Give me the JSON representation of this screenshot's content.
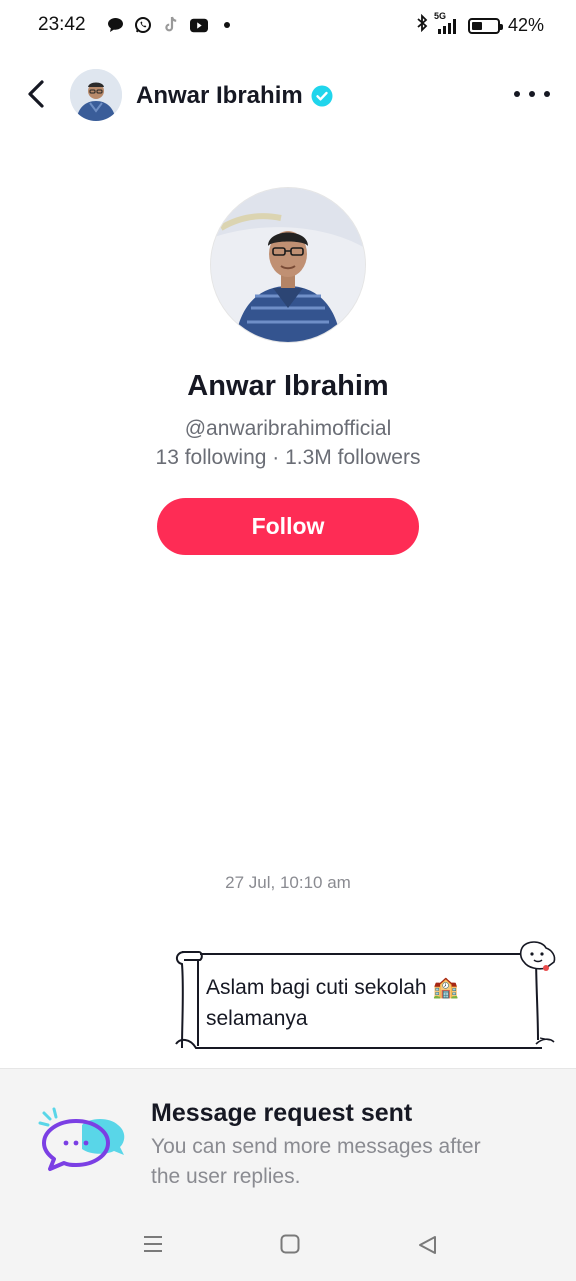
{
  "status_bar": {
    "time": "23:42",
    "battery_percent": "42%",
    "battery_level": 0.42,
    "network": "5G",
    "icons": [
      "chat-bubble-icon",
      "whatsapp-icon",
      "tiktok-icon",
      "youtube-icon",
      "dot-icon",
      "bluetooth-icon",
      "signal-icon",
      "battery-icon"
    ]
  },
  "header": {
    "name": "Anwar Ibrahim",
    "verified": true,
    "icons": [
      "back-arrow-icon",
      "verified-badge-icon",
      "more-icon"
    ]
  },
  "profile": {
    "name": "Anwar Ibrahim",
    "handle": "@anwaribrahimofficial",
    "stats": "13 following · 1.3M followers",
    "follow_label": "Follow"
  },
  "chat": {
    "timestamp": "27 Jul, 10:10 am",
    "message": "Aslam bagi cuti sekolah 🏫 selamanya"
  },
  "request": {
    "title": "Message request sent",
    "subtitle": "You can send more messages after the user replies."
  },
  "colors": {
    "accent": "#fe2c55",
    "verified": "#20d5ec",
    "request_icon_purple": "#7b3fe4",
    "request_icon_cyan": "#59d6e8"
  },
  "nav": {
    "icons": [
      "menu-icon",
      "home-square-icon",
      "back-triangle-icon"
    ]
  }
}
